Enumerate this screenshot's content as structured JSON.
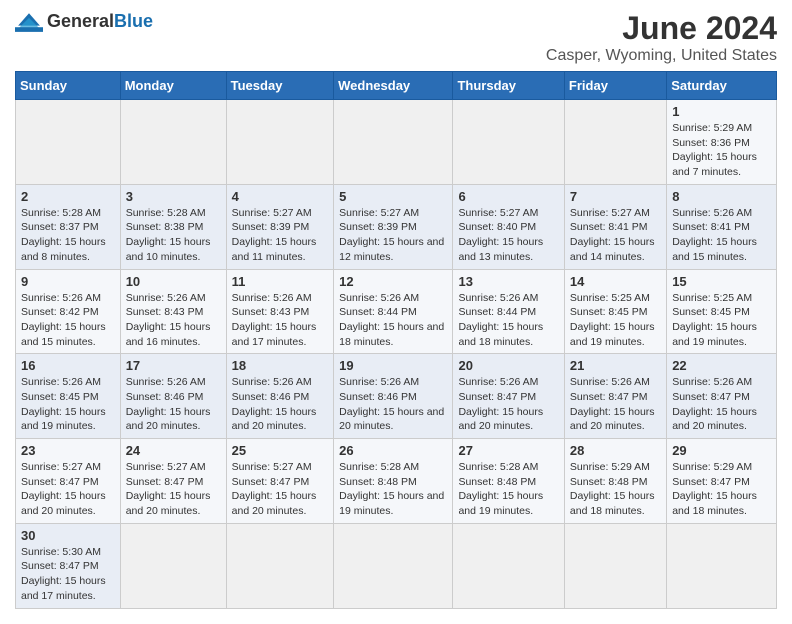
{
  "header": {
    "logo_general": "General",
    "logo_blue": "Blue",
    "title": "June 2024",
    "subtitle": "Casper, Wyoming, United States"
  },
  "days_of_week": [
    "Sunday",
    "Monday",
    "Tuesday",
    "Wednesday",
    "Thursday",
    "Friday",
    "Saturday"
  ],
  "weeks": [
    [
      {
        "date": "",
        "sunrise": "",
        "sunset": "",
        "daylight": ""
      },
      {
        "date": "",
        "sunrise": "",
        "sunset": "",
        "daylight": ""
      },
      {
        "date": "",
        "sunrise": "",
        "sunset": "",
        "daylight": ""
      },
      {
        "date": "",
        "sunrise": "",
        "sunset": "",
        "daylight": ""
      },
      {
        "date": "",
        "sunrise": "",
        "sunset": "",
        "daylight": ""
      },
      {
        "date": "",
        "sunrise": "",
        "sunset": "",
        "daylight": ""
      },
      {
        "date": "1",
        "sunrise": "Sunrise: 5:29 AM",
        "sunset": "Sunset: 8:36 PM",
        "daylight": "Daylight: 15 hours and 7 minutes."
      }
    ],
    [
      {
        "date": "2",
        "sunrise": "Sunrise: 5:28 AM",
        "sunset": "Sunset: 8:37 PM",
        "daylight": "Daylight: 15 hours and 8 minutes."
      },
      {
        "date": "3",
        "sunrise": "Sunrise: 5:28 AM",
        "sunset": "Sunset: 8:38 PM",
        "daylight": "Daylight: 15 hours and 10 minutes."
      },
      {
        "date": "4",
        "sunrise": "Sunrise: 5:27 AM",
        "sunset": "Sunset: 8:39 PM",
        "daylight": "Daylight: 15 hours and 11 minutes."
      },
      {
        "date": "5",
        "sunrise": "Sunrise: 5:27 AM",
        "sunset": "Sunset: 8:39 PM",
        "daylight": "Daylight: 15 hours and 12 minutes."
      },
      {
        "date": "6",
        "sunrise": "Sunrise: 5:27 AM",
        "sunset": "Sunset: 8:40 PM",
        "daylight": "Daylight: 15 hours and 13 minutes."
      },
      {
        "date": "7",
        "sunrise": "Sunrise: 5:27 AM",
        "sunset": "Sunset: 8:41 PM",
        "daylight": "Daylight: 15 hours and 14 minutes."
      },
      {
        "date": "8",
        "sunrise": "Sunrise: 5:26 AM",
        "sunset": "Sunset: 8:41 PM",
        "daylight": "Daylight: 15 hours and 15 minutes."
      }
    ],
    [
      {
        "date": "9",
        "sunrise": "Sunrise: 5:26 AM",
        "sunset": "Sunset: 8:42 PM",
        "daylight": "Daylight: 15 hours and 15 minutes."
      },
      {
        "date": "10",
        "sunrise": "Sunrise: 5:26 AM",
        "sunset": "Sunset: 8:43 PM",
        "daylight": "Daylight: 15 hours and 16 minutes."
      },
      {
        "date": "11",
        "sunrise": "Sunrise: 5:26 AM",
        "sunset": "Sunset: 8:43 PM",
        "daylight": "Daylight: 15 hours and 17 minutes."
      },
      {
        "date": "12",
        "sunrise": "Sunrise: 5:26 AM",
        "sunset": "Sunset: 8:44 PM",
        "daylight": "Daylight: 15 hours and 18 minutes."
      },
      {
        "date": "13",
        "sunrise": "Sunrise: 5:26 AM",
        "sunset": "Sunset: 8:44 PM",
        "daylight": "Daylight: 15 hours and 18 minutes."
      },
      {
        "date": "14",
        "sunrise": "Sunrise: 5:25 AM",
        "sunset": "Sunset: 8:45 PM",
        "daylight": "Daylight: 15 hours and 19 minutes."
      },
      {
        "date": "15",
        "sunrise": "Sunrise: 5:25 AM",
        "sunset": "Sunset: 8:45 PM",
        "daylight": "Daylight: 15 hours and 19 minutes."
      }
    ],
    [
      {
        "date": "16",
        "sunrise": "Sunrise: 5:26 AM",
        "sunset": "Sunset: 8:45 PM",
        "daylight": "Daylight: 15 hours and 19 minutes."
      },
      {
        "date": "17",
        "sunrise": "Sunrise: 5:26 AM",
        "sunset": "Sunset: 8:46 PM",
        "daylight": "Daylight: 15 hours and 20 minutes."
      },
      {
        "date": "18",
        "sunrise": "Sunrise: 5:26 AM",
        "sunset": "Sunset: 8:46 PM",
        "daylight": "Daylight: 15 hours and 20 minutes."
      },
      {
        "date": "19",
        "sunrise": "Sunrise: 5:26 AM",
        "sunset": "Sunset: 8:46 PM",
        "daylight": "Daylight: 15 hours and 20 minutes."
      },
      {
        "date": "20",
        "sunrise": "Sunrise: 5:26 AM",
        "sunset": "Sunset: 8:47 PM",
        "daylight": "Daylight: 15 hours and 20 minutes."
      },
      {
        "date": "21",
        "sunrise": "Sunrise: 5:26 AM",
        "sunset": "Sunset: 8:47 PM",
        "daylight": "Daylight: 15 hours and 20 minutes."
      },
      {
        "date": "22",
        "sunrise": "Sunrise: 5:26 AM",
        "sunset": "Sunset: 8:47 PM",
        "daylight": "Daylight: 15 hours and 20 minutes."
      }
    ],
    [
      {
        "date": "23",
        "sunrise": "Sunrise: 5:27 AM",
        "sunset": "Sunset: 8:47 PM",
        "daylight": "Daylight: 15 hours and 20 minutes."
      },
      {
        "date": "24",
        "sunrise": "Sunrise: 5:27 AM",
        "sunset": "Sunset: 8:47 PM",
        "daylight": "Daylight: 15 hours and 20 minutes."
      },
      {
        "date": "25",
        "sunrise": "Sunrise: 5:27 AM",
        "sunset": "Sunset: 8:47 PM",
        "daylight": "Daylight: 15 hours and 20 minutes."
      },
      {
        "date": "26",
        "sunrise": "Sunrise: 5:28 AM",
        "sunset": "Sunset: 8:48 PM",
        "daylight": "Daylight: 15 hours and 19 minutes."
      },
      {
        "date": "27",
        "sunrise": "Sunrise: 5:28 AM",
        "sunset": "Sunset: 8:48 PM",
        "daylight": "Daylight: 15 hours and 19 minutes."
      },
      {
        "date": "28",
        "sunrise": "Sunrise: 5:29 AM",
        "sunset": "Sunset: 8:48 PM",
        "daylight": "Daylight: 15 hours and 18 minutes."
      },
      {
        "date": "29",
        "sunrise": "Sunrise: 5:29 AM",
        "sunset": "Sunset: 8:47 PM",
        "daylight": "Daylight: 15 hours and 18 minutes."
      }
    ],
    [
      {
        "date": "30",
        "sunrise": "Sunrise: 5:30 AM",
        "sunset": "Sunset: 8:47 PM",
        "daylight": "Daylight: 15 hours and 17 minutes."
      },
      {
        "date": "",
        "sunrise": "",
        "sunset": "",
        "daylight": ""
      },
      {
        "date": "",
        "sunrise": "",
        "sunset": "",
        "daylight": ""
      },
      {
        "date": "",
        "sunrise": "",
        "sunset": "",
        "daylight": ""
      },
      {
        "date": "",
        "sunrise": "",
        "sunset": "",
        "daylight": ""
      },
      {
        "date": "",
        "sunrise": "",
        "sunset": "",
        "daylight": ""
      },
      {
        "date": "",
        "sunrise": "",
        "sunset": "",
        "daylight": ""
      }
    ]
  ]
}
